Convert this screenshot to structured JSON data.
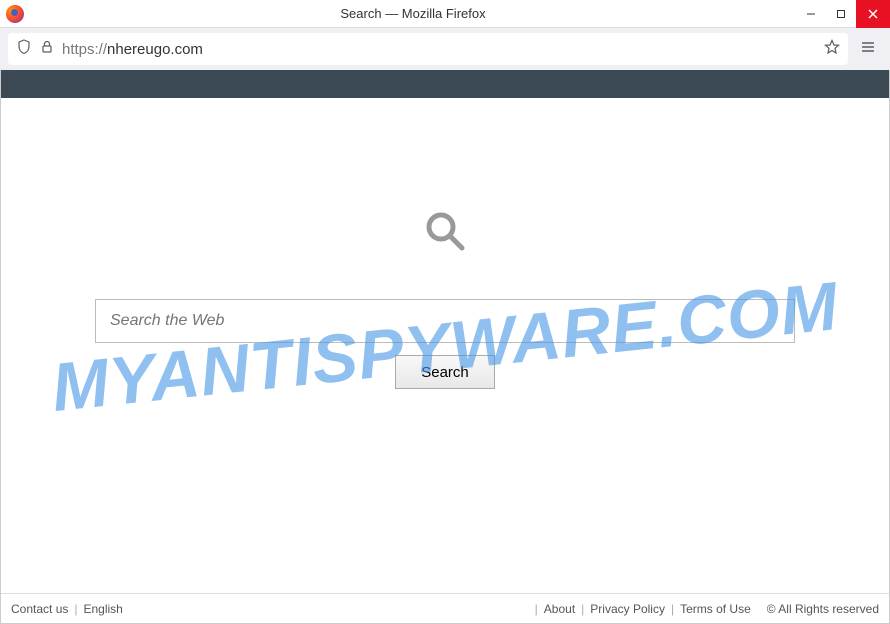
{
  "window": {
    "title": "Search — Mozilla Firefox"
  },
  "addressbar": {
    "protocol": "https://",
    "domain": "nhereugo.com"
  },
  "page": {
    "search_placeholder": "Search the Web",
    "search_button": "Search"
  },
  "footer": {
    "contact": "Contact us",
    "language": "English",
    "about": "About",
    "privacy": "Privacy Policy",
    "terms": "Terms of Use",
    "copyright": "© All Rights reserved"
  },
  "watermark": "MYANTISPYWARE.COM"
}
